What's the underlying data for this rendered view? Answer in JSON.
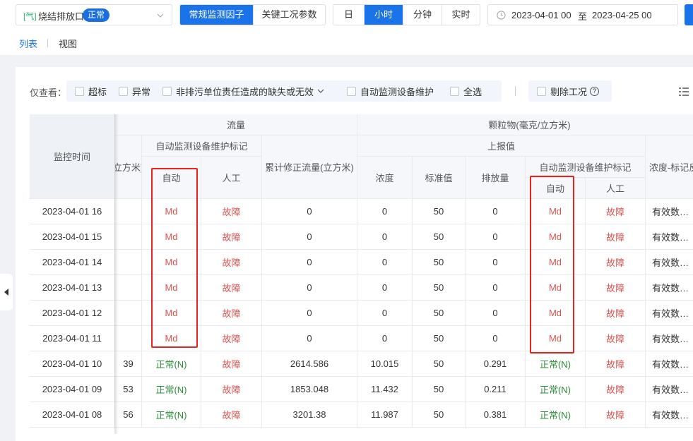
{
  "toolbar": {
    "outlet_tag": "[气]",
    "outlet_name": "烧结排放口",
    "outlet_status": "正常",
    "factor_tabs": [
      "常规监测因子",
      "关键工况参数"
    ],
    "granularity_tabs": [
      "日",
      "小时",
      "分钟",
      "实时"
    ],
    "date_start": "2023-04-01 00",
    "date_sep": "至",
    "date_end": "2023-04-25 00"
  },
  "view_tabs": {
    "list": "列表",
    "chart": "视图"
  },
  "filters": {
    "label": "仅查看：",
    "options": [
      "超标",
      "异常",
      "非排污单位责任造成的缺失或无效",
      "自动监测设备维护",
      "全选"
    ],
    "exclude": "剔除工况"
  },
  "table": {
    "time_header": "监控时间",
    "flow_group": "流量",
    "flow_partial_col": "立方米)",
    "maint_mark": "自动监测设备维护标记",
    "auto": "自动",
    "manual": "人工",
    "cum_flow": "累计修正流量(立方米)",
    "pm_group": "颗粒物(毫克/立方米)",
    "reported": "上报值",
    "conc": "浓度",
    "std": "标准值",
    "emission": "排放量",
    "conc_mark": "浓度-标记反",
    "rows": [
      {
        "time": "2023-04-01 16",
        "flow": "",
        "auto": "Md",
        "manual": "故障",
        "cum": "0",
        "conc": "0",
        "std": "50",
        "emis": "0",
        "pm_auto": "Md",
        "pm_manual": "故障",
        "mark": "有效数…"
      },
      {
        "time": "2023-04-01 15",
        "flow": "",
        "auto": "Md",
        "manual": "故障",
        "cum": "0",
        "conc": "0",
        "std": "50",
        "emis": "0",
        "pm_auto": "Md",
        "pm_manual": "故障",
        "mark": "有效数…"
      },
      {
        "time": "2023-04-01 14",
        "flow": "",
        "auto": "Md",
        "manual": "故障",
        "cum": "0",
        "conc": "0",
        "std": "50",
        "emis": "0",
        "pm_auto": "Md",
        "pm_manual": "故障",
        "mark": "有效数…"
      },
      {
        "time": "2023-04-01 13",
        "flow": "",
        "auto": "Md",
        "manual": "故障",
        "cum": "0",
        "conc": "0",
        "std": "50",
        "emis": "0",
        "pm_auto": "Md",
        "pm_manual": "故障",
        "mark": "有效数…"
      },
      {
        "time": "2023-04-01 12",
        "flow": "",
        "auto": "Md",
        "manual": "故障",
        "cum": "0",
        "conc": "0",
        "std": "50",
        "emis": "0",
        "pm_auto": "Md",
        "pm_manual": "故障",
        "mark": "有效数…"
      },
      {
        "time": "2023-04-01 11",
        "flow": "",
        "auto": "Md",
        "manual": "故障",
        "cum": "0",
        "conc": "0",
        "std": "50",
        "emis": "0",
        "pm_auto": "Md",
        "pm_manual": "故障",
        "mark": "有效数…"
      },
      {
        "time": "2023-04-01 10",
        "flow": "39",
        "auto": "正常(N)",
        "manual": "故障",
        "cum": "2614.586",
        "conc": "10.015",
        "std": "50",
        "emis": "0.291",
        "pm_auto": "正常(N)",
        "pm_manual": "故障",
        "mark": "有效数…"
      },
      {
        "time": "2023-04-01 09",
        "flow": "53",
        "auto": "正常(N)",
        "manual": "故障",
        "cum": "1853.048",
        "conc": "11.432",
        "std": "50",
        "emis": "0.211",
        "pm_auto": "正常(N)",
        "pm_manual": "故障",
        "mark": "有效数…"
      },
      {
        "time": "2023-04-01 08",
        "flow": "56",
        "auto": "正常(N)",
        "manual": "故障",
        "cum": "3201.38",
        "conc": "11.987",
        "std": "50",
        "emis": "0.381",
        "pm_auto": "正常(N)",
        "pm_manual": "故障",
        "mark": "有效数…"
      }
    ]
  },
  "colors": {
    "primary": "#1a73e8",
    "fault": "#d9534f",
    "ok": "#2e8b3a",
    "highlight": "#e8221d"
  }
}
